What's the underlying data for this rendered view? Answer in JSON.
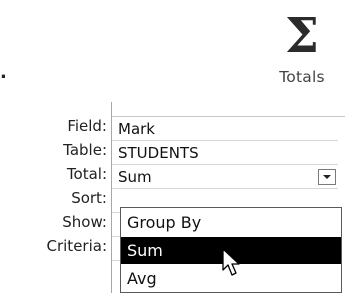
{
  "ribbon": {
    "totals_icon": "sigma-icon",
    "totals_glyph": "Σ",
    "totals_label": "Totals",
    "stray_mark": "."
  },
  "grid": {
    "rows": [
      {
        "label": "Field:",
        "value": "Mark"
      },
      {
        "label": "Table:",
        "value": "STUDENTS"
      },
      {
        "label": "Total:",
        "value": "Sum"
      },
      {
        "label": "Sort:",
        "value": ""
      },
      {
        "label": "Show:",
        "value": ""
      },
      {
        "label": "Criteria:",
        "value": ""
      }
    ]
  },
  "total_dropdown": {
    "selected": "Sum",
    "options": [
      "Group By",
      "Sum",
      "Avg"
    ],
    "highlighted": "Sum",
    "arrow_icon": "chevron-down-icon"
  },
  "cursor": {
    "icon": "mouse-pointer-icon"
  },
  "colors": {
    "highlight_bg": "#000000",
    "highlight_fg": "#ffffff",
    "grid_border": "#a8a8a8"
  }
}
